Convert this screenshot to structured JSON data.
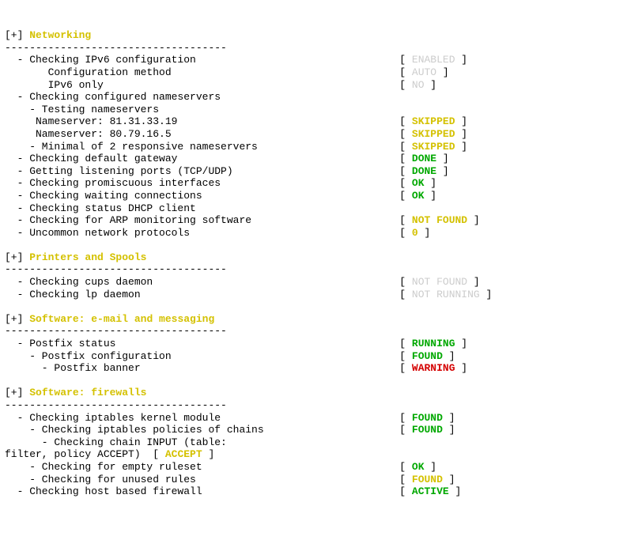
{
  "sections": [
    {
      "title": "Networking",
      "items": [
        {
          "indent": 1,
          "text": "Checking IPv6 configuration",
          "status": "ENABLED",
          "statusClass": "status-gray"
        },
        {
          "indent": 3,
          "text": "  Configuration method",
          "status": "AUTO",
          "statusClass": "status-gray",
          "noBullet": true
        },
        {
          "indent": 3,
          "text": "  IPv6 only",
          "status": "NO",
          "statusClass": "status-gray",
          "noBullet": true
        },
        {
          "indent": 1,
          "text": "Checking configured nameservers"
        },
        {
          "indent": 2,
          "text": "Testing nameservers"
        },
        {
          "indent": 3,
          "text": "Nameserver: 81.31.33.19",
          "status": "SKIPPED",
          "statusClass": "status-yellow",
          "noBullet": true
        },
        {
          "indent": 3,
          "text": "Nameserver: 80.79.16.5",
          "status": "SKIPPED",
          "statusClass": "status-yellow",
          "noBullet": true
        },
        {
          "indent": 2,
          "text": "Minimal of 2 responsive nameservers",
          "status": "SKIPPED",
          "statusClass": "status-yellow"
        },
        {
          "indent": 1,
          "text": "Checking default gateway",
          "status": "DONE",
          "statusClass": "status-green"
        },
        {
          "indent": 1,
          "text": "Getting listening ports (TCP/UDP)",
          "status": "DONE",
          "statusClass": "status-green"
        },
        {
          "indent": 1,
          "text": "Checking promiscuous interfaces",
          "status": "OK",
          "statusClass": "status-green"
        },
        {
          "indent": 1,
          "text": "Checking waiting connections",
          "status": "OK",
          "statusClass": "status-green"
        },
        {
          "indent": 1,
          "text": "Checking status DHCP client"
        },
        {
          "indent": 1,
          "text": "Checking for ARP monitoring software",
          "status": "NOT FOUND",
          "statusClass": "status-yellow"
        },
        {
          "indent": 1,
          "text": "Uncommon network protocols",
          "status": "0",
          "statusClass": "status-yellow"
        }
      ]
    },
    {
      "title": "Printers and Spools",
      "items": [
        {
          "indent": 1,
          "text": "Checking cups daemon",
          "status": "NOT FOUND",
          "statusClass": "status-gray"
        },
        {
          "indent": 1,
          "text": "Checking lp daemon",
          "status": "NOT RUNNING",
          "statusClass": "status-gray"
        }
      ]
    },
    {
      "title": "Software: e-mail and messaging",
      "items": [
        {
          "indent": 1,
          "text": "Postfix status",
          "status": "RUNNING",
          "statusClass": "status-green"
        },
        {
          "indent": 2,
          "text": "Postfix configuration",
          "status": "FOUND",
          "statusClass": "status-green"
        },
        {
          "indent": 3,
          "text": "Postfix banner",
          "status": "WARNING",
          "statusClass": "status-red"
        }
      ]
    },
    {
      "title": "Software: firewalls",
      "items": [
        {
          "indent": 1,
          "text": "Checking iptables kernel module",
          "status": "FOUND",
          "statusClass": "status-green"
        },
        {
          "indent": 2,
          "text": "Checking iptables policies of chains",
          "status": "FOUND",
          "statusClass": "status-green"
        },
        {
          "indent": 3,
          "text": "Checking chain INPUT (table:"
        }
      ],
      "multiline": {
        "text": "filter, policy ACCEPT)",
        "status": "ACCEPT",
        "statusClass": "status-yellow"
      },
      "moreItems": [
        {
          "indent": 2,
          "text": "Checking for empty ruleset",
          "status": "OK",
          "statusClass": "status-green"
        },
        {
          "indent": 2,
          "text": "Checking for unused rules",
          "status": "FOUND",
          "statusClass": "status-yellow"
        },
        {
          "indent": 1,
          "text": "Checking host based firewall",
          "status": "ACTIVE",
          "statusClass": "status-green"
        }
      ]
    }
  ],
  "dashLine": "------------------------------------",
  "statusColumn": 64
}
